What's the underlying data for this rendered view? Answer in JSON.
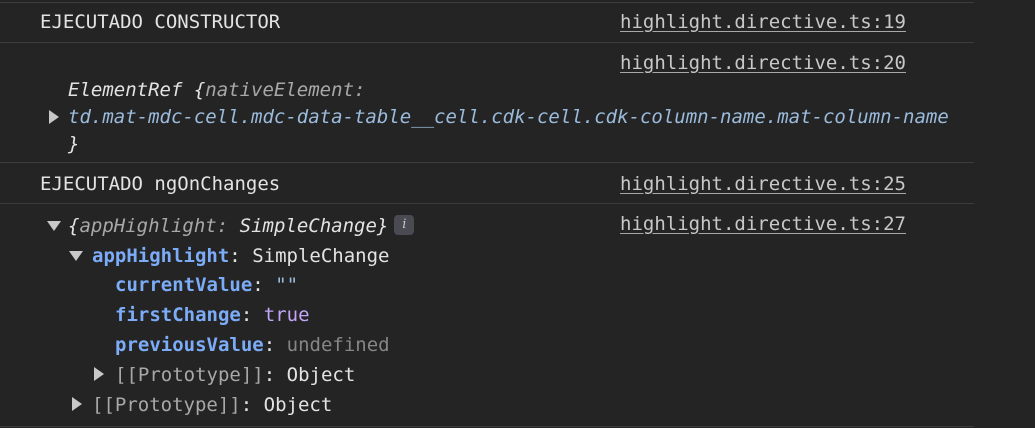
{
  "messages": {
    "m1": {
      "text": "EJECUTADO CONSTRUCTOR",
      "source": "highlight.directive.ts:19"
    },
    "m2": {
      "source": "highlight.directive.ts:20",
      "class_name": "ElementRef",
      "open_brace": "{",
      "prop_key": "nativeElement",
      "prop_colon": ":",
      "prop_value": "td.mat-mdc-cell.mdc-data-table__cell.cdk-cell.cdk-column-name.mat-column-name",
      "close_brace": "}"
    },
    "m3": {
      "text": "EJECUTADO ngOnChanges",
      "source": "highlight.directive.ts:25"
    },
    "m4": {
      "source": "highlight.directive.ts:27",
      "preview_open": "{",
      "preview_key": "appHighlight",
      "preview_colon": ":",
      "preview_type": "SimpleChange",
      "preview_close": "}",
      "info_icon": "i",
      "tree": {
        "appHighlight_key": "appHighlight",
        "appHighlight_sep": ":",
        "appHighlight_type": "SimpleChange",
        "currentValue_key": "currentValue",
        "currentValue_sep": ":",
        "currentValue_val": "\"\"",
        "firstChange_key": "firstChange",
        "firstChange_sep": ":",
        "firstChange_val": "true",
        "previousValue_key": "previousValue",
        "previousValue_sep": ":",
        "previousValue_val": "undefined",
        "proto_inner_key": "[[Prototype]]",
        "proto_inner_sep": ":",
        "proto_inner_val": "Object",
        "proto_outer_key": "[[Prototype]]",
        "proto_outer_sep": ":",
        "proto_outer_val": "Object"
      }
    }
  }
}
